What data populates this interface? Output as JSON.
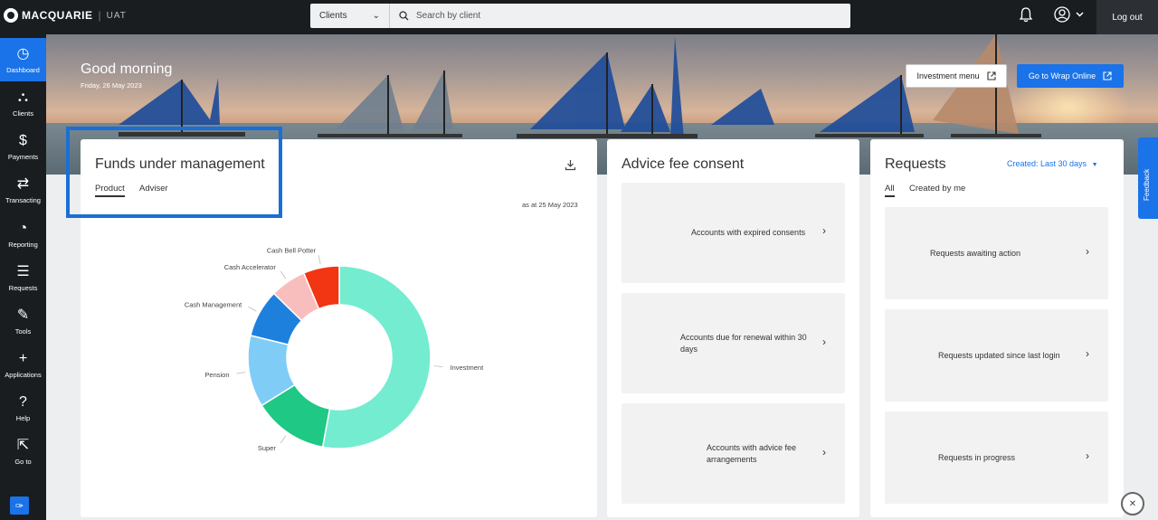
{
  "header": {
    "brand": "MACQUARIE",
    "env": "UAT",
    "search_select": "Clients",
    "search_placeholder": "Search by client",
    "logout": "Log out"
  },
  "sidebar": {
    "items": [
      {
        "label": "Dashboard",
        "icon": "gauge-icon",
        "glyph": "◷"
      },
      {
        "label": "Clients",
        "icon": "org-chart-icon",
        "glyph": "⛬"
      },
      {
        "label": "Payments",
        "icon": "dollar-icon",
        "glyph": "$"
      },
      {
        "label": "Transacting",
        "icon": "transfer-icon",
        "glyph": "⇄"
      },
      {
        "label": "Reporting",
        "icon": "pie-chart-icon",
        "glyph": "◔"
      },
      {
        "label": "Requests",
        "icon": "checklist-icon",
        "glyph": "☰"
      },
      {
        "label": "Tools",
        "icon": "wrench-icon",
        "glyph": "✎"
      },
      {
        "label": "Applications",
        "icon": "plus-icon",
        "glyph": "+"
      },
      {
        "label": "Help",
        "icon": "help-icon",
        "glyph": "?"
      },
      {
        "label": "Go to",
        "icon": "external-link-icon",
        "glyph": "⇱"
      }
    ]
  },
  "hero": {
    "greeting": "Good morning",
    "date": "Friday, 26 May 2023",
    "investment_menu": "Investment menu",
    "wrap_online": "Go to Wrap Online"
  },
  "funds": {
    "title": "Funds under management",
    "tabs": [
      "Product",
      "Adviser"
    ],
    "as_at": "as at 25 May 2023",
    "chart_data": {
      "type": "pie",
      "categories": [
        "Investment",
        "Super",
        "Pension",
        "Cash Management",
        "Cash Accelerator",
        "Cash Bell Potter"
      ],
      "values": [
        50,
        12.5,
        12,
        8,
        6,
        6
      ],
      "colors": [
        "#74ecd0",
        "#1fc884",
        "#7fcdf7",
        "#1e80dd",
        "#f8bebe",
        "#f23513"
      ]
    }
  },
  "advice": {
    "title": "Advice fee consent",
    "tiles": [
      "Accounts with expired consents",
      "Accounts due for renewal within 30 days",
      "Accounts with advice fee arrangements"
    ]
  },
  "requests": {
    "title": "Requests",
    "filter": "Created: Last 30 days",
    "tabs": [
      "All",
      "Created by me"
    ],
    "tiles": [
      "Requests awaiting action",
      "Requests updated since last login",
      "Requests in progress"
    ]
  },
  "feedback": "Feedback"
}
